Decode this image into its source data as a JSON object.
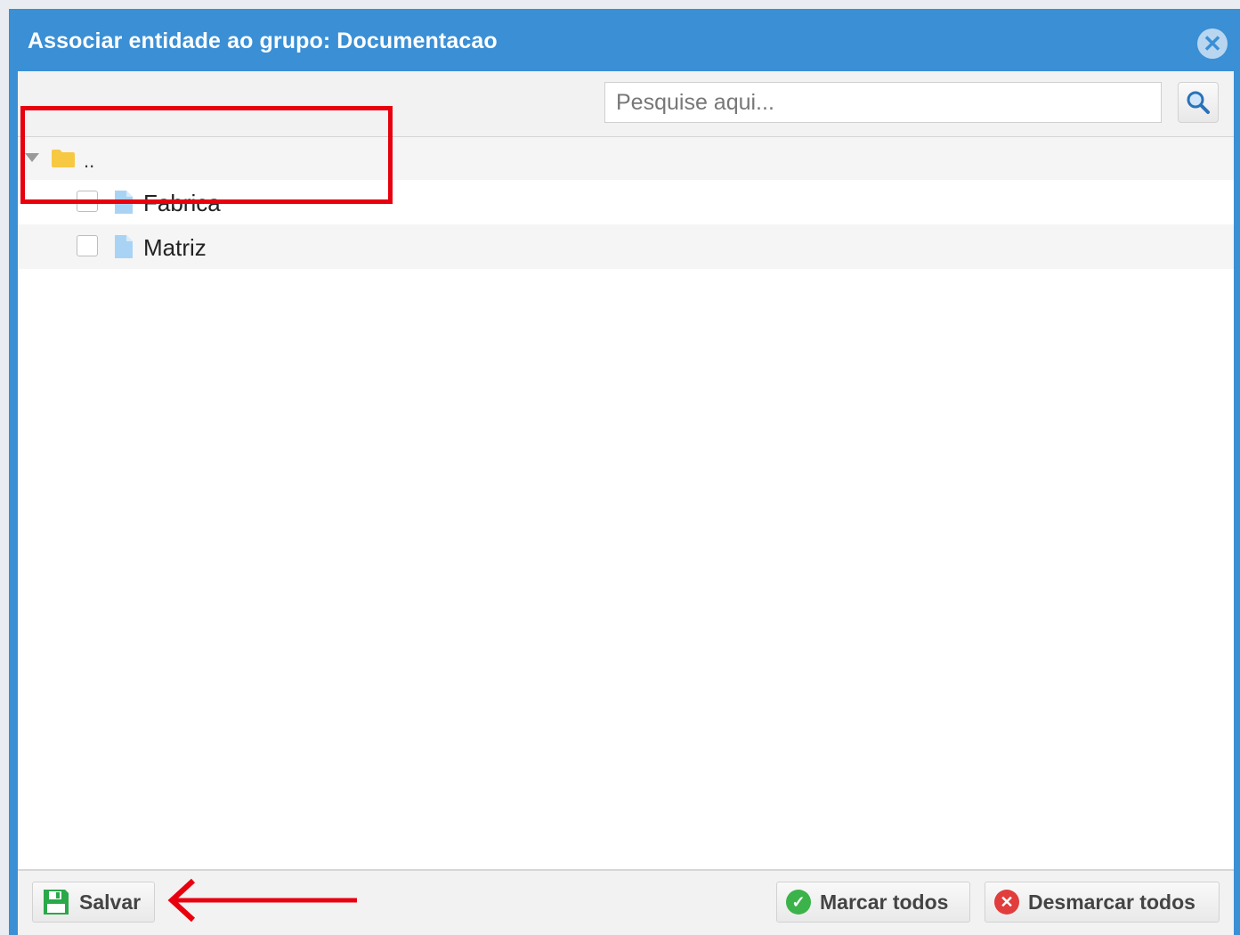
{
  "dialog": {
    "title": "Associar entidade ao grupo: Documentacao",
    "close_glyph": "✕"
  },
  "search": {
    "placeholder": "Pesquise aqui...",
    "value": ""
  },
  "tree": {
    "root_label": "..",
    "items": [
      {
        "label": "Fabrica",
        "checked": false,
        "icon": "file-icon"
      },
      {
        "label": "Matriz",
        "checked": false,
        "icon": "file-icon"
      }
    ]
  },
  "footer": {
    "save_label": "Salvar",
    "mark_all_label": "Marcar todos",
    "unmark_all_label": "Desmarcar todos"
  },
  "colors": {
    "title_bar": "#3a8fd5",
    "highlight": "#e8000e",
    "save_icon": "#2aa84a",
    "check": "#3cb34a",
    "x": "#e23d3d",
    "folder": "#f7c842",
    "file": "#a9d3f5"
  }
}
